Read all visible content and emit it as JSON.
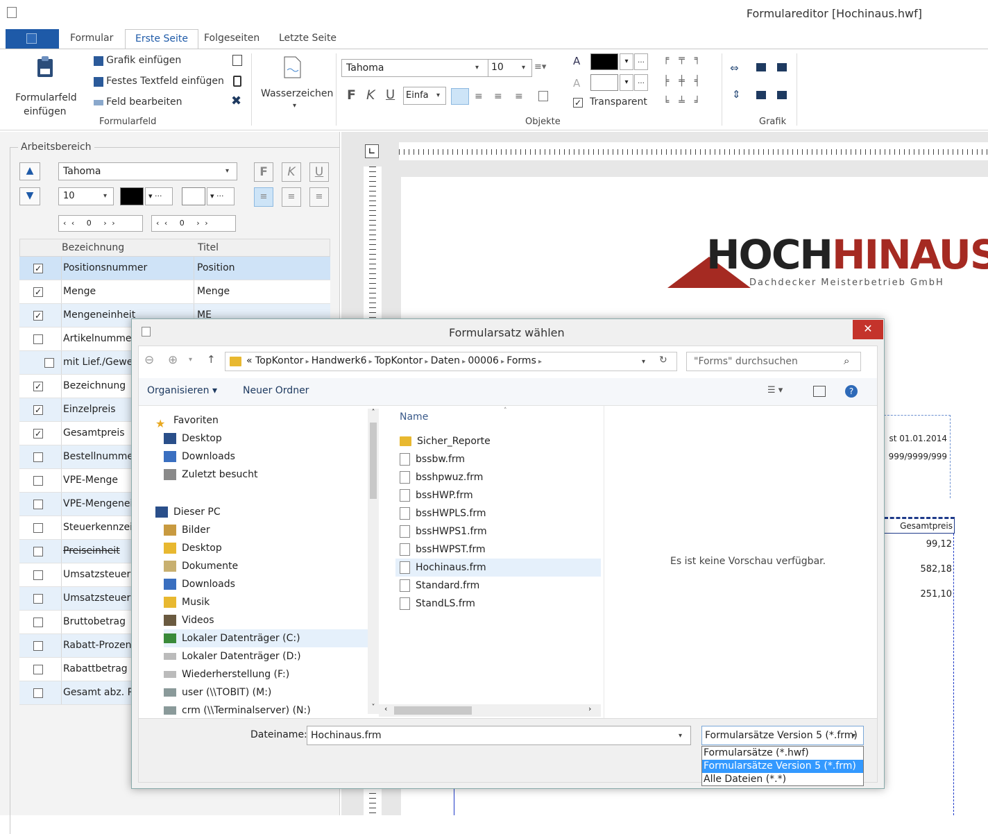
{
  "app": {
    "title": "Formulareditor [Hochinaus.hwf]"
  },
  "tabs": {
    "formular": "Formular",
    "erste_seite": "Erste Seite",
    "folgeseiten": "Folgeseiten",
    "letzte_seite": "Letzte Seite"
  },
  "ribbon": {
    "formularfeld": {
      "insert_line1": "Formularfeld",
      "insert_line2": "einfügen",
      "grafik": "Grafik einfügen",
      "textfeld": "Festes Textfeld einfügen",
      "bearbeiten": "Feld bearbeiten",
      "group": "Formularfeld"
    },
    "wasserzeichen": "Wasserzeichen",
    "objekte": {
      "font": "Tahoma",
      "size": "10",
      "align_value": "Einfa",
      "transparent": "Transparent",
      "group": "Objekte",
      "bold": "F",
      "italic": "K",
      "underline": "U"
    },
    "grafik": {
      "group": "Grafik"
    }
  },
  "panel": {
    "title": "Arbeitsbereich",
    "font": "Tahoma",
    "size": "10",
    "spin1": "0",
    "spin2": "0",
    "bold": "F",
    "italic": "K",
    "underline": "U",
    "col_bez": "Bezeichnung",
    "col_titel": "Titel",
    "rows": [
      {
        "label": "Positionsnummer",
        "title": "Position",
        "checked": "✓"
      },
      {
        "label": "Menge",
        "title": "Menge",
        "checked": "✓"
      },
      {
        "label": "Mengeneinheit",
        "title": "ME",
        "checked": "✓"
      },
      {
        "label": "Artikelnummer",
        "title": "",
        "checked": ""
      },
      {
        "label": "mit Lief./Gewerk",
        "title": "",
        "checked": ""
      },
      {
        "label": "Bezeichnung",
        "title": "",
        "checked": "✓"
      },
      {
        "label": "Einzelpreis",
        "title": "",
        "checked": "✓"
      },
      {
        "label": "Gesamtpreis",
        "title": "",
        "checked": "✓"
      },
      {
        "label": "Bestellnummer",
        "title": "",
        "checked": ""
      },
      {
        "label": "VPE-Menge",
        "title": "",
        "checked": ""
      },
      {
        "label": "VPE-Mengeneinheit",
        "title": "",
        "checked": ""
      },
      {
        "label": "Steuerkennzeichen",
        "title": "",
        "checked": ""
      },
      {
        "label": "Preiseinheit",
        "title": "",
        "checked": ""
      },
      {
        "label": "Umsatzsteuer in %",
        "title": "",
        "checked": ""
      },
      {
        "label": "Umsatzsteuer als Betrag",
        "title": "",
        "checked": ""
      },
      {
        "label": "Bruttobetrag",
        "title": "",
        "checked": ""
      },
      {
        "label": "Rabatt-Prozent",
        "title": "",
        "checked": ""
      },
      {
        "label": "Rabattbetrag",
        "title": "",
        "checked": ""
      },
      {
        "label": "Gesamt abz. Rabatt",
        "title": "",
        "checked": ""
      }
    ]
  },
  "page": {
    "logo_main": "HOCH",
    "logo_accent": "HINAUS",
    "logo_sub": "Dachdecker Meisterbetrieb GmbH",
    "field1": "st 01.01.2014",
    "field2": "999/9999/999",
    "col_header": "Gesamtpreis",
    "values": [
      "99,12",
      "582,18",
      "251,10"
    ]
  },
  "dialog": {
    "title": "Formularsatz wählen",
    "close": "✕",
    "path": [
      "«",
      "TopKontor",
      "Handwerk6",
      "TopKontor",
      "Daten",
      "00006",
      "Forms"
    ],
    "search_placeholder": "\"Forms\" durchsuchen",
    "organize": "Organisieren ▾",
    "new_folder": "Neuer Ordner",
    "favorites": "Favoriten",
    "fav_items": [
      "Desktop",
      "Downloads",
      "Zuletzt besucht"
    ],
    "this_pc": "Dieser PC",
    "pc_items": [
      "Bilder",
      "Desktop",
      "Dokumente",
      "Downloads",
      "Musik",
      "Videos",
      "Lokaler Datenträger (C:)",
      "Lokaler Datenträger (D:)",
      "Wiederherstellung (F:)",
      "user (\\\\TOBIT) (M:)",
      "crm (\\\\Terminalserver) (N:)"
    ],
    "col_name": "Name",
    "files": [
      "Sicher_Reporte",
      "bssbw.frm",
      "bsshpwuz.frm",
      "bssHWP.frm",
      "bssHWPLS.frm",
      "bssHWPS1.frm",
      "bssHWPST.frm",
      "Hochinaus.frm",
      "Standard.frm",
      "StandLS.frm"
    ],
    "preview": "Es ist keine Vorschau verfügbar.",
    "filename_label": "Dateiname:",
    "filename_value": "Hochinaus.frm",
    "filetype_selected": "Formularsätze Version 5 (*.frm)",
    "filetype_options": [
      "Formularsätze (*.hwf)",
      "Formularsätze Version 5 (*.frm)",
      "Alle Dateien (*.*)"
    ]
  },
  "colors": {
    "accent": "#1e5aa8",
    "logo_red": "#a52a22",
    "close_red": "#c4332b",
    "selection": "#3399ff"
  }
}
